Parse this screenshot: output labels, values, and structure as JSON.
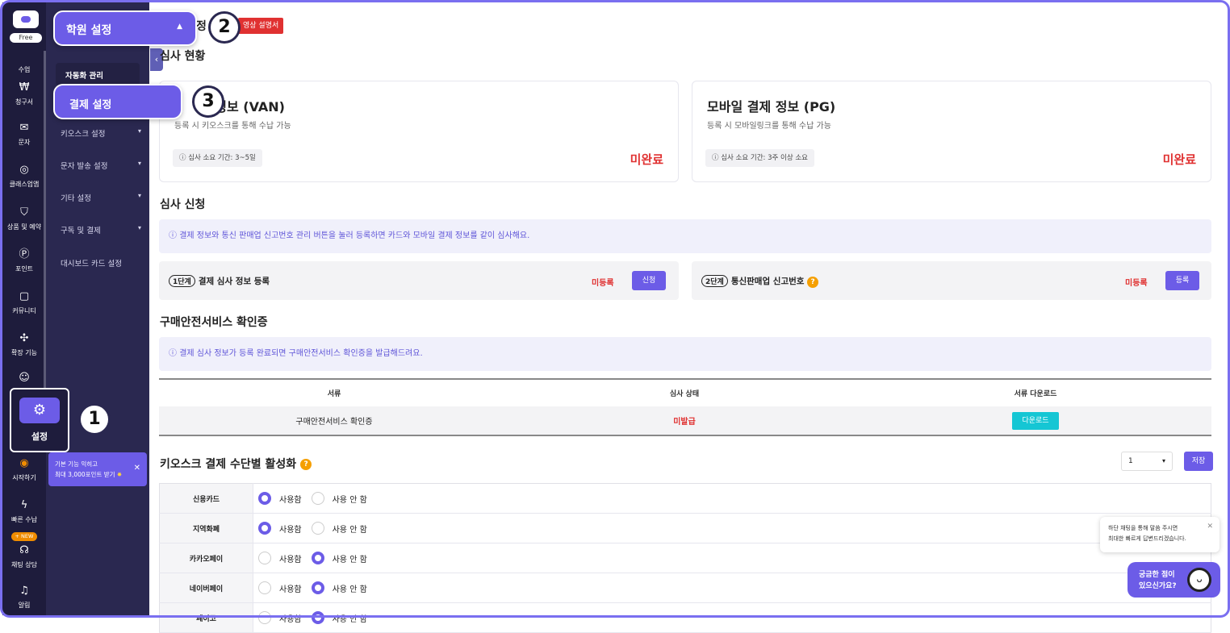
{
  "rail": {
    "free": "Free",
    "items": [
      {
        "label": "수업",
        "icon": "book-icon"
      },
      {
        "label": "청구서",
        "icon": "won-icon"
      },
      {
        "label": "문자",
        "icon": "mail-icon"
      },
      {
        "label": "클래스업앱",
        "icon": "app-icon"
      },
      {
        "label": "상품 및 예약",
        "icon": "bag-icon"
      },
      {
        "label": "포인트",
        "icon": "point-icon"
      },
      {
        "label": "커뮤니티",
        "icon": "chat-icon"
      },
      {
        "label": "확장 기능",
        "icon": "puzzle-icon"
      }
    ],
    "settings": "설정",
    "bottom": [
      {
        "label": "시작하기",
        "icon": "start-icon"
      },
      {
        "label": "빠른 수납",
        "icon": "bolt-icon"
      },
      {
        "label": "채팅 상담",
        "icon": "headset-icon"
      },
      {
        "label": "알림",
        "icon": "bell-icon"
      }
    ],
    "new_badge": "+ NEW"
  },
  "sidebar": {
    "header": "학원 설정",
    "items": [
      "자동화 관리",
      "결제 설정",
      "키오스크 설정",
      "문자 발송 설정",
      "기타 설정",
      "구독 및 결제",
      "대시보드 카드 설정"
    ]
  },
  "tooltip": {
    "line1": "기본 기능 익히고",
    "line2": "최대 3,000포인트 받기",
    "close": "✕"
  },
  "badges": [
    "1",
    "2",
    "3"
  ],
  "main": {
    "title": "정",
    "video_badge": "영상 설명서",
    "review_status": "심사 현황",
    "van": {
      "title": "결제 정보 (VAN)",
      "title_vis": "드 정보 (VAN)",
      "desc": "등록 시 키오스크를 통해 수납 가능",
      "chip": "심사 소요 기간: 3~5일",
      "status": "미완료"
    },
    "pg": {
      "title": "모바일 결제 정보 (PG)",
      "desc": "등록 시 모바일링크를 통해 수납 가능",
      "chip": "심사 소요 기간: 3주 이상 소요",
      "status": "미완료"
    },
    "apply_title": "심사 신청",
    "apply_info": "결제 정보와 통신 판매업 신고번호 관리 버튼을 눌러 등록하면 카드와 모바일 결제 정보를 같이 심사해요.",
    "step1": {
      "pill": "1단계",
      "label": "결제 심사 정보 등록",
      "status": "미등록",
      "button": "신청"
    },
    "step2": {
      "pill": "2단계",
      "label": "통신판매업 신고번호",
      "status": "미등록",
      "button": "등록"
    },
    "safe_title": "구매안전서비스 확인증",
    "safe_info": "결제 심사 정보가 등록 완료되면 구매안전서비스 확인증을 발급해드려요.",
    "doc_table": {
      "headers": [
        "서류",
        "심사 상태",
        "서류 다운로드"
      ],
      "row": {
        "doc": "구매안전서비스 확인증",
        "status": "미발급",
        "button": "다운로드"
      }
    },
    "kiosk_title": "키오스크 결제 수단별 활성화",
    "select_value": "1",
    "save": "저장",
    "payments": [
      {
        "name": "신용카드",
        "on": "use"
      },
      {
        "name": "지역화폐",
        "on": "use"
      },
      {
        "name": "카카오페이",
        "on": "nouse"
      },
      {
        "name": "네이버페이",
        "on": "nouse"
      },
      {
        "name": "페이코",
        "on": "nouse"
      }
    ],
    "use_label": "사용함",
    "nouse_label": "사용 안 함"
  },
  "chat": {
    "bubble1": "하단 채팅을 통해 말씀 주시면",
    "bubble2": "최대한 빠르게 답변드리겠습니다.",
    "close": "✕",
    "button1": "궁금한 점이",
    "button2": "있으신가요?"
  }
}
